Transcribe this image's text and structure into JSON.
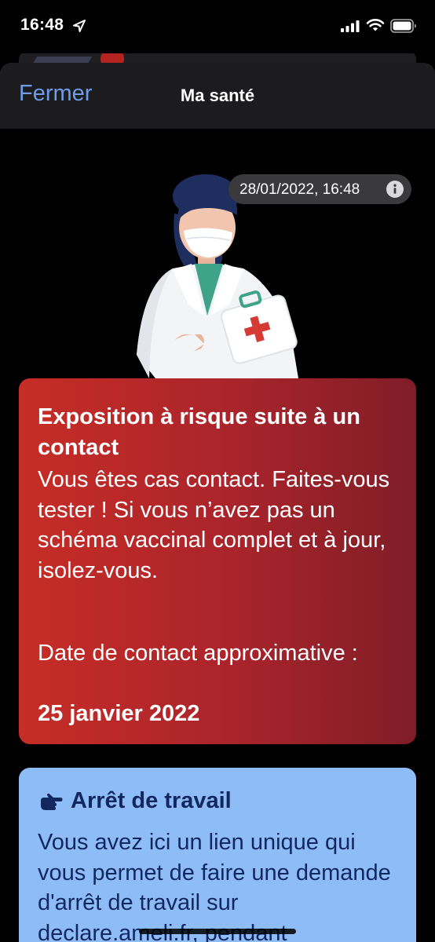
{
  "status_bar": {
    "time": "16:48",
    "icons": [
      "location-arrow-icon",
      "cellular-signal-icon",
      "wifi-icon",
      "battery-icon"
    ]
  },
  "nav": {
    "close_label": "Fermer",
    "title": "Ma santé"
  },
  "timestamp": {
    "text": "28/01/2022, 16:48",
    "icon": "info-icon"
  },
  "alert": {
    "title": "Exposition à risque suite à un contact",
    "body": "Vous êtes cas contact. Faites-vous tester ! Si vous n’avez pas un schéma vaccinal complet et à jour, isolez-vous.",
    "date_label": "Date de contact approximative :",
    "date_value": "25 janvier 2022"
  },
  "work_leave": {
    "icon": "pointing-hand-icon",
    "title": "Arrêt de travail",
    "body": "Vous avez ici un lien unique qui vous permet de faire une demande d'arrêt de travail sur declare.ameli.fr, pendant"
  },
  "colors": {
    "background": "#000000",
    "nav_accent": "#6e9bea",
    "alert_start": "#c72d26",
    "alert_end": "#7f1d27",
    "work_card": "#8ebcf7",
    "work_text": "#13275f"
  }
}
